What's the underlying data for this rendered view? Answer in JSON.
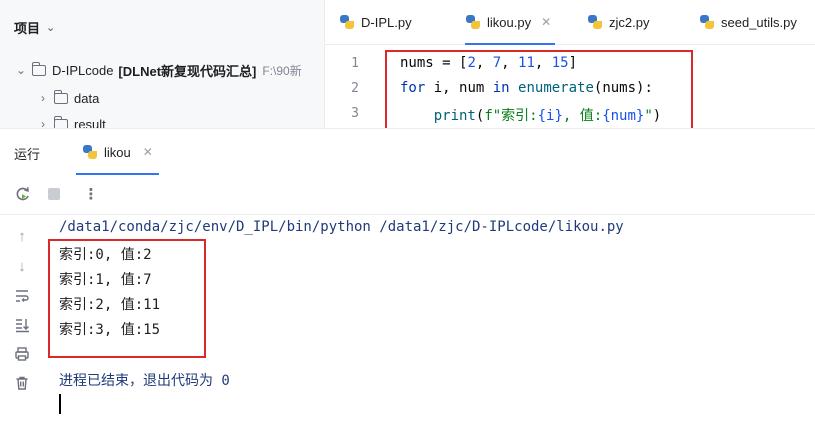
{
  "project": {
    "header": "项目",
    "root": {
      "name": "D-IPLcode",
      "bracket": "[DLNet新复现代码汇总]",
      "path": "F:\\90新"
    },
    "items": [
      "data",
      "result"
    ]
  },
  "editor": {
    "tabs": [
      {
        "label": "D-IPL.py",
        "active": false
      },
      {
        "label": "likou.py",
        "active": true
      },
      {
        "label": "zjc2.py",
        "active": false
      },
      {
        "label": "seed_utils.py",
        "active": false
      }
    ],
    "line_numbers": [
      "1",
      "2",
      "3"
    ],
    "code": {
      "l1": {
        "a": "nums = [",
        "n1": "2",
        "c1": ", ",
        "n2": "7",
        "c2": ", ",
        "n3": "11",
        "c3": ", ",
        "n4": "15",
        "end": "]"
      },
      "l2": {
        "kw1": "for",
        "a": " i, num ",
        "kw2": "in",
        "b": " ",
        "fn": "enumerate",
        "c": "(nums):"
      },
      "l3": {
        "indent": "    ",
        "fn": "print",
        "a": "(",
        "s1": "f\"索引:",
        "b1": "{i}",
        "s2": ", 值:",
        "b2": "{num}",
        "s3": "\"",
        "end": ")"
      }
    }
  },
  "run": {
    "title": "运行",
    "tab_label": "likou",
    "command": "/data1/conda/zjc/env/D_IPL/bin/python /data1/zjc/D-IPLcode/likou.py",
    "output": [
      "索引:0, 值:2",
      "索引:1, 值:7",
      "索引:2, 值:11",
      "索引:3, 值:15"
    ],
    "exit_message": "进程已结束，退出代码为 0"
  },
  "icons": {
    "rerun": "rerun-icon",
    "stop": "stop-icon",
    "more": "more-vertical-icon",
    "up": "arrow-up-icon",
    "down": "arrow-down-icon",
    "wrap": "soft-wrap-icon",
    "scroll_end": "scroll-to-end-icon",
    "print": "print-icon",
    "trash": "trash-icon"
  },
  "colors": {
    "highlight_box": "#d9292b",
    "accent": "#3574f0"
  }
}
